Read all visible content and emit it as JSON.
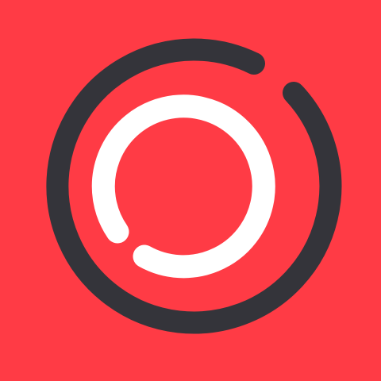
{
  "icon": {
    "name": "app-icon-concentric-broken-rings",
    "colors": {
      "background": "#FF3B45",
      "outer_ring": "#34343A",
      "inner_ring": "#FFFFFF"
    }
  }
}
